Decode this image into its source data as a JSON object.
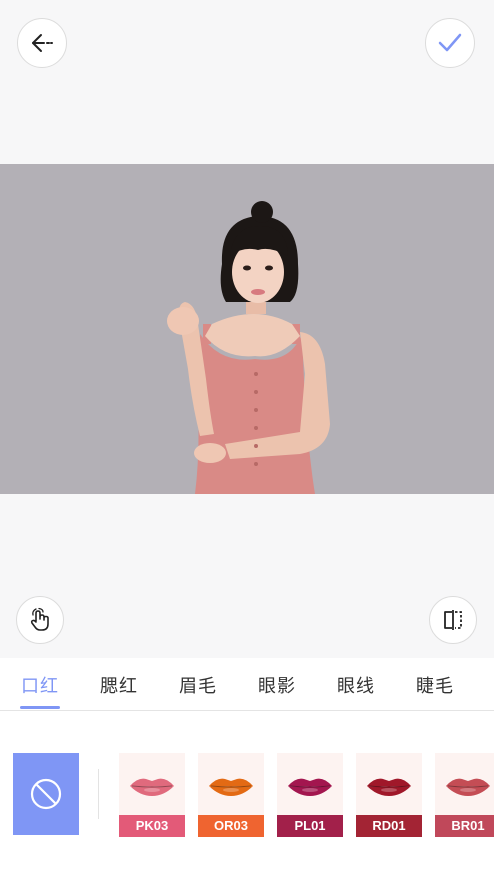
{
  "tabs": [
    {
      "label": "口红",
      "active": true
    },
    {
      "label": "腮红"
    },
    {
      "label": "眉毛"
    },
    {
      "label": "眼影"
    },
    {
      "label": "眼线"
    },
    {
      "label": "睫毛"
    }
  ],
  "accent_color": "#7f96f5",
  "swatches": [
    {
      "code": "PK03",
      "lip_color": "#e06a7d",
      "label_bg": "#e35a78"
    },
    {
      "code": "OR03",
      "lip_color": "#e36a14",
      "label_bg": "#ef6430"
    },
    {
      "code": "PL01",
      "lip_color": "#a3164f",
      "label_bg": "#a2204a"
    },
    {
      "code": "RD01",
      "lip_color": "#a0182a",
      "label_bg": "#a32434"
    },
    {
      "code": "BR01",
      "lip_color": "#c44d55",
      "label_bg": "#c0485a"
    }
  ],
  "icons": {
    "back": "arrow-left-icon",
    "confirm": "checkmark-icon",
    "gesture": "hand-touch-icon",
    "compare": "compare-split-icon",
    "none": "prohibited-icon"
  }
}
